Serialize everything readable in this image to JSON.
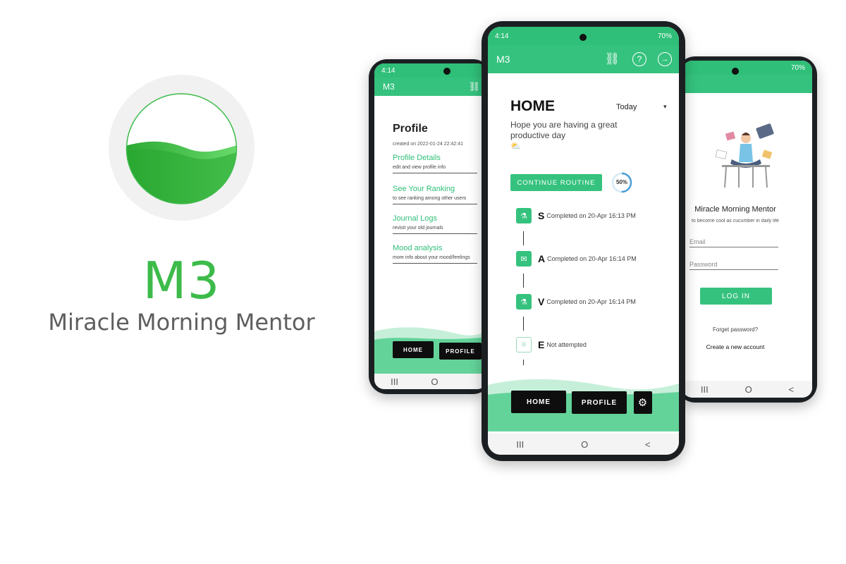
{
  "brand": {
    "title": "M3",
    "subtitle": "Miracle Morning Mentor"
  },
  "colors": {
    "accent": "#35c27e",
    "brand_green": "#3dbb4a",
    "dark_button": "#0e0e0e"
  },
  "center_phone": {
    "status": {
      "time": "4:14",
      "right": "70%"
    },
    "appbar": {
      "title": "M3",
      "icons": [
        "link-icon",
        "help-icon",
        "logout-icon"
      ]
    },
    "home": {
      "title": "HOME",
      "filter_value": "Today",
      "greeting": "Hope you are having a great productive day",
      "continue_label": "CONTINUE ROUTINE",
      "progress_label": "50%",
      "progress_fraction": 0.5,
      "timeline": [
        {
          "letter": "S",
          "text": "Completed on 20-Apr 16:13 PM",
          "done": true
        },
        {
          "letter": "A",
          "text": "Completed on 20-Apr 16:14 PM",
          "done": true
        },
        {
          "letter": "V",
          "text": "Completed on 20-Apr 16:14 PM",
          "done": true
        },
        {
          "letter": "E",
          "text": "Not attempted",
          "done": false
        }
      ]
    },
    "bottom_nav": {
      "home_label": "HOME",
      "profile_label": "PROFILE"
    },
    "nav": {
      "recents": "III",
      "home": "O",
      "back": "<"
    }
  },
  "left_phone": {
    "status": {
      "time": "4:14"
    },
    "appbar": {
      "title": "M3"
    },
    "profile": {
      "title": "Profile",
      "created": "created on 2022-01-24 22:42:41",
      "items": [
        {
          "title": "Profile Details",
          "subtitle": "edit and view profile info"
        },
        {
          "title": "See Your Ranking",
          "subtitle": "to see ranking among other users"
        },
        {
          "title": "Journal Logs",
          "subtitle": "revisit your old journals"
        },
        {
          "title": "Mood analysis",
          "subtitle": "more info about your mood/feelings"
        }
      ]
    },
    "bottom_nav": {
      "home_label": "HOME",
      "profile_label": "PROFILE"
    },
    "nav": {
      "recents": "III",
      "home": "O"
    }
  },
  "right_phone": {
    "status": {
      "right": "70%"
    },
    "login": {
      "title": "Miracle Morning Mentor",
      "tagline": "to become cool as cucumber in daily life",
      "email_placeholder": "Email",
      "password_placeholder": "Password",
      "login_label": "LOG IN",
      "forgot_label": "Forget password?",
      "create_label": "Create a new account"
    },
    "nav": {
      "recents": "III",
      "home": "O",
      "back": "<"
    }
  }
}
